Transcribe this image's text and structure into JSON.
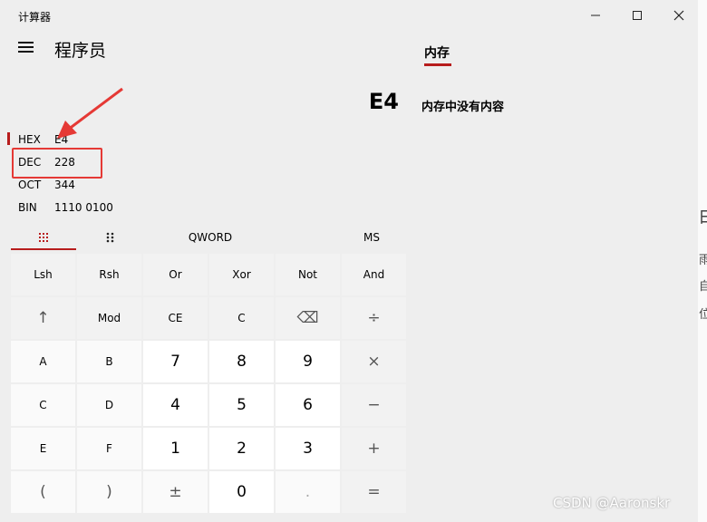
{
  "window": {
    "title": "计算器",
    "minimize_icon": "minimize-icon",
    "maximize_icon": "maximize-icon",
    "close_icon": "close-icon"
  },
  "header": {
    "menu_icon": "hamburger-icon",
    "mode": "程序员"
  },
  "memory": {
    "tab_label": "内存",
    "empty_text": "内存中没有内容",
    "accent": "#b71c1c"
  },
  "display": {
    "value": "E4"
  },
  "radix": [
    {
      "label": "HEX",
      "value": "E4",
      "selected": true
    },
    {
      "label": "DEC",
      "value": "228",
      "selected": false
    },
    {
      "label": "OCT",
      "value": "344",
      "selected": false
    },
    {
      "label": "BIN",
      "value": "1110 0100",
      "selected": false
    }
  ],
  "annotation": {
    "color": "#e53935"
  },
  "keypad_tabs": {
    "full_keypad_icon": "full-keypad-icon",
    "bit_toggle_icon": "bit-toggle-icon",
    "word_size": "QWORD",
    "memory_store": "MS"
  },
  "keys": [
    [
      "Lsh",
      "Rsh",
      "Or",
      "Xor",
      "Not",
      "And"
    ],
    [
      "↑",
      "Mod",
      "CE",
      "C",
      "⌫",
      "÷"
    ],
    [
      "A",
      "B",
      "7",
      "8",
      "9",
      "×"
    ],
    [
      "C",
      "D",
      "4",
      "5",
      "6",
      "−"
    ],
    [
      "E",
      "F",
      "1",
      "2",
      "3",
      "+"
    ],
    [
      "(",
      ")",
      "±",
      "0",
      ".",
      "="
    ]
  ],
  "side_chars": [
    "由",
    "雨",
    "自",
    "位"
  ],
  "watermark": "CSDN @Aaronskr"
}
